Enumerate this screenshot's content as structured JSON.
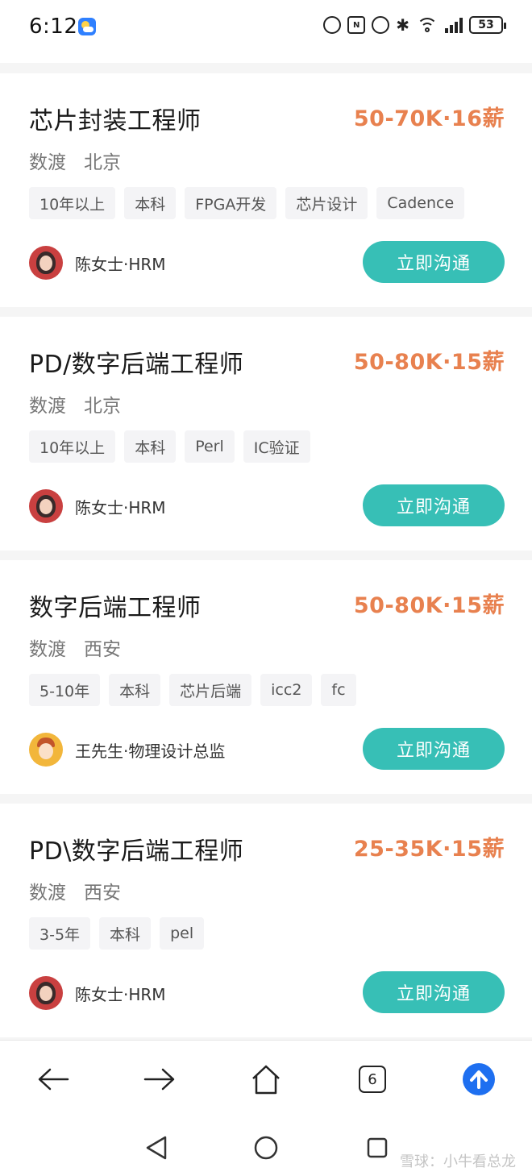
{
  "status_bar": {
    "time": "6:12",
    "nfc_label": "N",
    "battery": "53"
  },
  "jobs": [
    {
      "title": "芯片封装工程师",
      "salary": "50-70K·16薪",
      "company": "数渡",
      "city": "北京",
      "tags": [
        "10年以上",
        "本科",
        "FPGA开发",
        "芯片设计",
        "Cadence"
      ],
      "recruiter": "陈女士·HRM",
      "cta": "立即沟通"
    },
    {
      "title": "PD/数字后端工程师",
      "salary": "50-80K·15薪",
      "company": "数渡",
      "city": "北京",
      "tags": [
        "10年以上",
        "本科",
        "Perl",
        "IC验证"
      ],
      "recruiter": "陈女士·HRM",
      "cta": "立即沟通"
    },
    {
      "title": "数字后端工程师",
      "salary": "50-80K·15薪",
      "company": "数渡",
      "city": "西安",
      "tags": [
        "5-10年",
        "本科",
        "芯片后端",
        "icc2",
        "fc"
      ],
      "recruiter": "王先生·物理设计总监",
      "cta": "立即沟通"
    },
    {
      "title": "PD\\数字后端工程师",
      "salary": "25-35K·15薪",
      "company": "数渡",
      "city": "西安",
      "tags": [
        "3-5年",
        "本科",
        "pel"
      ],
      "recruiter": "陈女士·HRM",
      "cta": "立即沟通"
    }
  ],
  "browser_nav": {
    "tab_count": "6"
  },
  "watermark": "雪球：小牛看总龙",
  "colors": {
    "salary": "#e8814f",
    "chat_button": "#37bfb6",
    "upload_button": "#1e6ff0"
  },
  "icons": {
    "nav": [
      "back-arrow-icon",
      "forward-arrow-icon",
      "home-icon",
      "tabs-icon",
      "upload-icon"
    ],
    "system": [
      "back-triangle-icon",
      "home-circle-icon",
      "recents-square-icon"
    ]
  }
}
